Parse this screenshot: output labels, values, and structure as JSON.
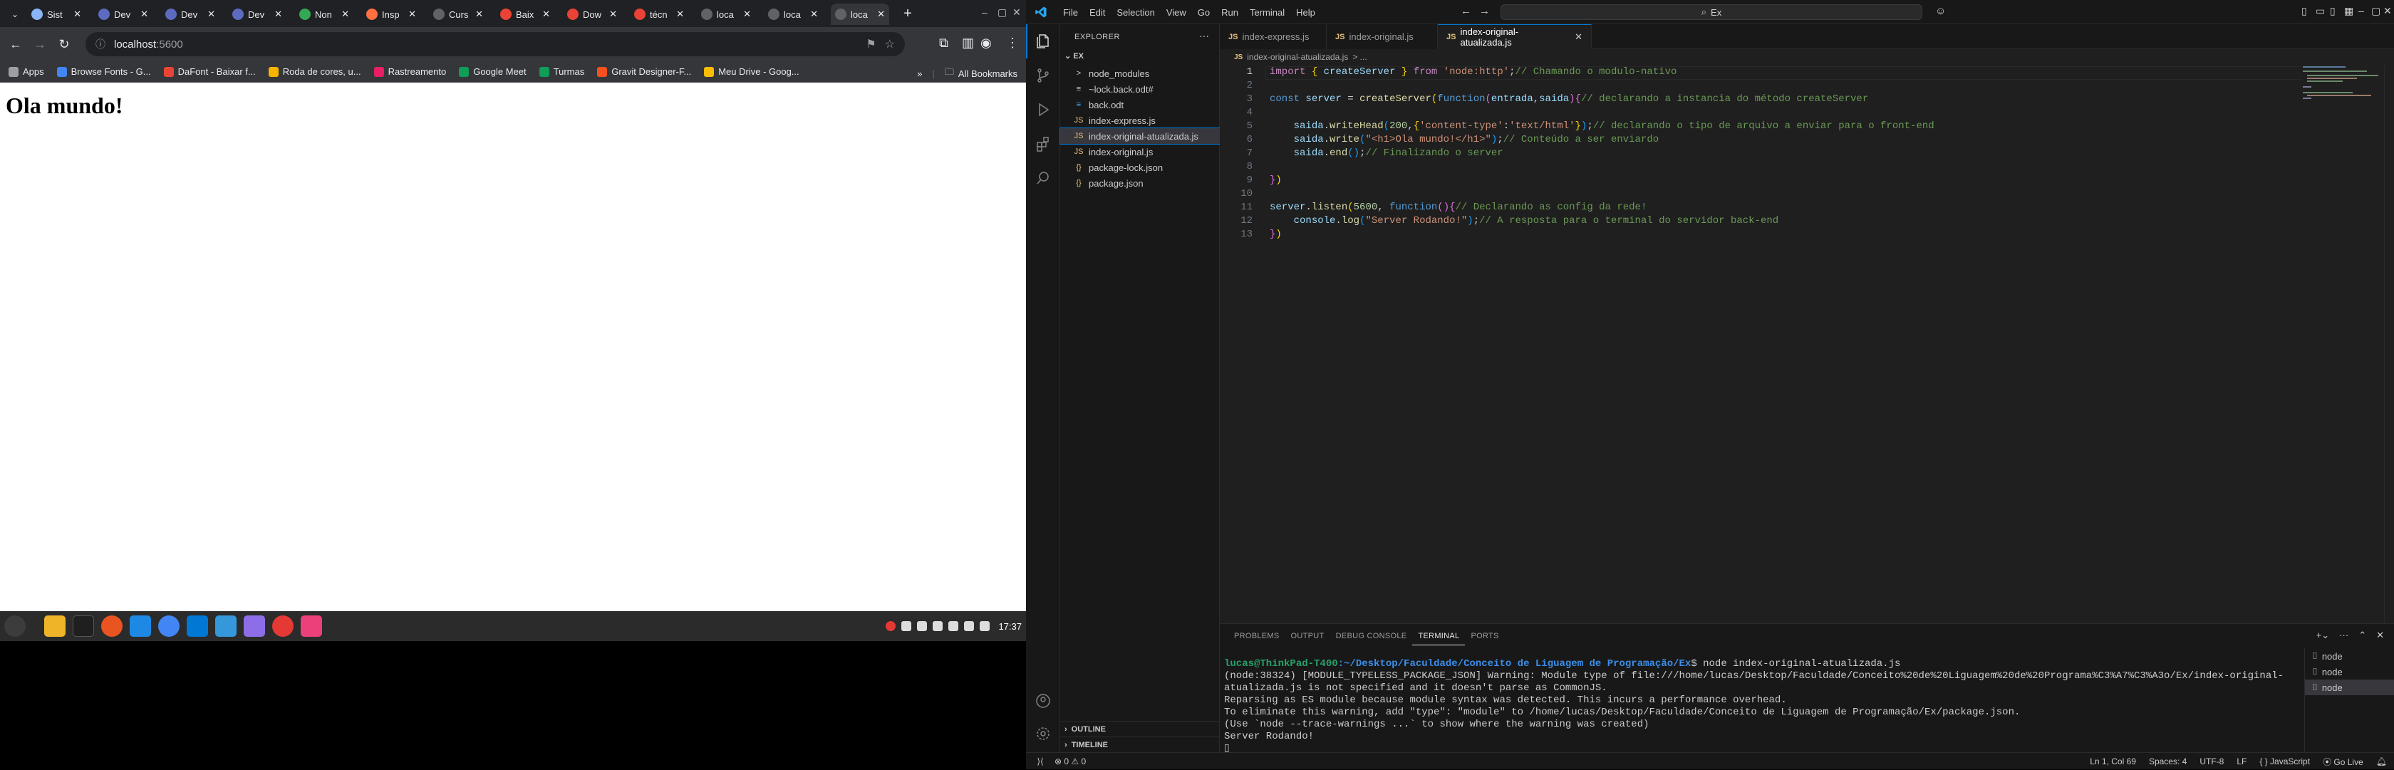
{
  "chrome": {
    "tabs": [
      {
        "title": "Sist",
        "color": "#8ab4f8"
      },
      {
        "title": "Dev",
        "color": "#5c6bc0"
      },
      {
        "title": "Dev",
        "color": "#5c6bc0"
      },
      {
        "title": "Dev",
        "color": "#5c6bc0"
      },
      {
        "title": "Non",
        "color": "#34a853"
      },
      {
        "title": "Insp",
        "color": "#ff7043"
      },
      {
        "title": "Curs",
        "color": "#5f6368"
      },
      {
        "title": "Baix",
        "color": "#ea4335"
      },
      {
        "title": "Dow",
        "color": "#ea4335"
      },
      {
        "title": "técn",
        "color": "#ea4335"
      },
      {
        "title": "loca",
        "color": "#5f6368"
      },
      {
        "title": "loca",
        "color": "#5f6368"
      },
      {
        "title": "loca",
        "color": "#5f6368"
      }
    ],
    "url_host": "localhost",
    "url_port": ":5600",
    "bookmarks": [
      {
        "label": "Apps",
        "color": "#9aa0a6"
      },
      {
        "label": "Browse Fonts - G...",
        "color": "#4285f4"
      },
      {
        "label": "DaFont - Baixar f...",
        "color": "#ea4335"
      },
      {
        "label": "Roda de cores, u...",
        "color": "#f4b400"
      },
      {
        "label": "Rastreamento",
        "color": "#e91e63"
      },
      {
        "label": "Google Meet",
        "color": "#0f9d58"
      },
      {
        "label": "Turmas",
        "color": "#0f9d58"
      },
      {
        "label": "Gravit Designer-F...",
        "color": "#f4511e"
      },
      {
        "label": "Meu Drive - Goog...",
        "color": "#fbbc04"
      }
    ],
    "all_bookmarks": "All Bookmarks",
    "page_heading": "Ola mundo!",
    "clock": "17:37"
  },
  "vscode": {
    "menu": [
      "File",
      "Edit",
      "Selection",
      "View",
      "Go",
      "Run",
      "Terminal",
      "Help"
    ],
    "search": "Ex",
    "explorer_title": "EXPLORER",
    "folder": "EX",
    "files": [
      {
        "name": "node_modules",
        "icon": ">",
        "color": "#cccccc"
      },
      {
        "name": "~lock.back.odt#",
        "icon": "≡",
        "color": "#cccccc"
      },
      {
        "name": "back.odt",
        "icon": "≡",
        "color": "#42a5f5"
      },
      {
        "name": "index-express.js",
        "icon": "JS",
        "color": "#e5c07b"
      },
      {
        "name": "index-original-atualizada.js",
        "icon": "JS",
        "color": "#e5c07b"
      },
      {
        "name": "index-original.js",
        "icon": "JS",
        "color": "#e5c07b"
      },
      {
        "name": "package-lock.json",
        "icon": "{}",
        "color": "#e5c07b"
      },
      {
        "name": "package.json",
        "icon": "{}",
        "color": "#e5c07b"
      }
    ],
    "outline": "OUTLINE",
    "timeline": "TIMELINE",
    "tabs": [
      "index-express.js",
      "index-original.js",
      "index-original-atualizada.js"
    ],
    "breadcrumb_file": "index-original-atualizada.js",
    "breadcrumb_tail": "> ...",
    "code_lines": [
      "1",
      "2",
      "3",
      "4",
      "5",
      "6",
      "7",
      "8",
      "9",
      "10",
      "11",
      "12",
      "13"
    ],
    "panel_tabs": [
      "PROBLEMS",
      "OUTPUT",
      "DEBUG CONSOLE",
      "TERMINAL",
      "PORTS"
    ],
    "terminal": {
      "user": "lucas@ThinkPad-T400",
      "path": ":~/Desktop/Faculdade/Conceito de Liguagem de Programação/Ex",
      "cmd": "$ node index-original-atualizada.js",
      "out": [
        "(node:38324) [MODULE_TYPELESS_PACKAGE_JSON] Warning: Module type of file:///home/lucas/Desktop/Faculdade/Conceito%20de%20Liguagem%20de%20Programa%C3%A7%C3%A3o/Ex/index-original-",
        "atualizada.js is not specified and it doesn't parse as CommonJS.",
        "Reparsing as ES module because module syntax was detected. This incurs a performance overhead.",
        "To eliminate this warning, add \"type\": \"module\" to /home/lucas/Desktop/Faculdade/Conceito de Liguagem de Programação/Ex/package.json.",
        "(Use `node --trace-warnings ...` to show where the warning was created)",
        "Server Rodando!"
      ]
    },
    "terminal_list": [
      "node",
      "node",
      "node"
    ],
    "status": {
      "errors": "⊗ 0 ⚠ 0",
      "position": "Ln 1, Col 69",
      "spaces": "Spaces: 4",
      "encoding": "UTF-8",
      "eol": "LF",
      "language": "{ } JavaScript",
      "golive": "Go Live"
    }
  },
  "colors": {
    "accent": "#0078d4",
    "chrome_tab_bg": "#202124"
  }
}
